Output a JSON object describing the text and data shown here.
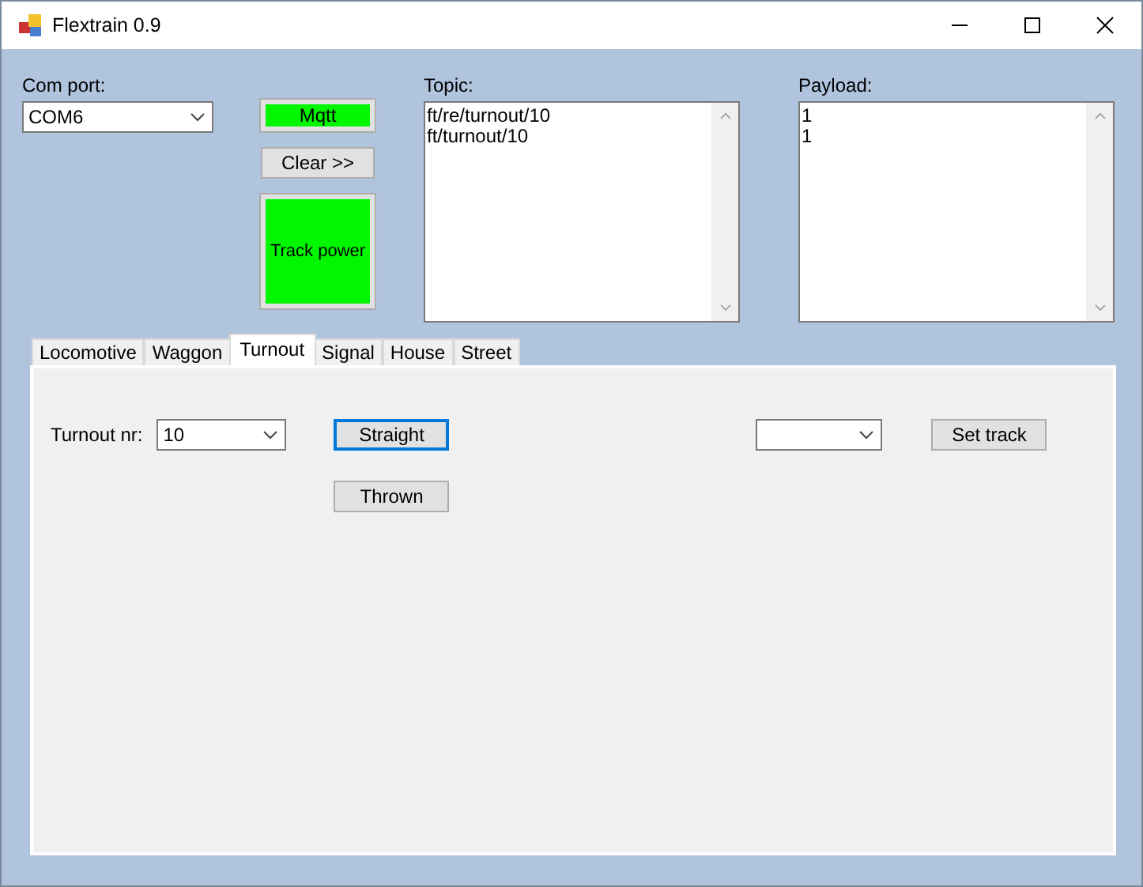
{
  "window": {
    "title": "Flextrain 0.9"
  },
  "com_port": {
    "label": "Com port:",
    "value": "COM6"
  },
  "mqtt_button": {
    "label": "Mqtt",
    "on": true
  },
  "clear_button": {
    "label": "Clear >>"
  },
  "track_power_button": {
    "label": "Track power",
    "on": true
  },
  "topic": {
    "label": "Topic:",
    "lines": [
      "ft/re/turnout/10",
      "ft/turnout/10"
    ]
  },
  "payload": {
    "label": "Payload:",
    "lines": [
      "1",
      "1"
    ]
  },
  "tabs": [
    {
      "label": "Locomotive",
      "selected": false
    },
    {
      "label": "Waggon",
      "selected": false
    },
    {
      "label": "Turnout",
      "selected": true
    },
    {
      "label": "Signal",
      "selected": false
    },
    {
      "label": "House",
      "selected": false
    },
    {
      "label": "Street",
      "selected": false
    }
  ],
  "turnout_nr": {
    "label": "Turnout nr:",
    "value": "10"
  },
  "straight_button": {
    "label": "Straight",
    "focused": true
  },
  "thrown_button": {
    "label": "Thrown",
    "focused": false
  },
  "set_track_button": {
    "label": "Set track"
  }
}
